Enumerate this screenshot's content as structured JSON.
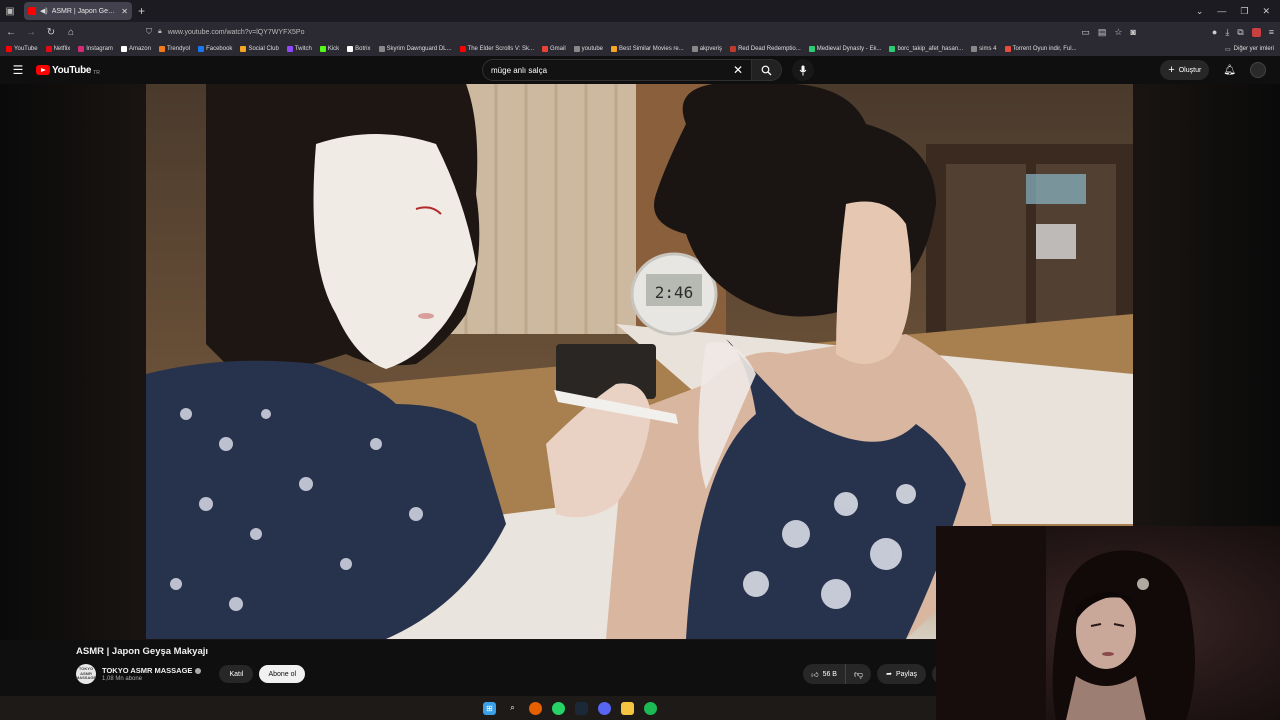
{
  "browser": {
    "tab_title": "ASMR | Japon Geyşa Makyajı",
    "url": "www.youtube.com/watch?v=lQY7WYFX5Po"
  },
  "bookmarks": [
    {
      "label": "YouTube",
      "color": "#ff0000"
    },
    {
      "label": "Netflix",
      "color": "#e50914"
    },
    {
      "label": "Instagram",
      "color": "#d62976"
    },
    {
      "label": "Amazon",
      "color": "#ffffff"
    },
    {
      "label": "Trendyol",
      "color": "#f27a1a"
    },
    {
      "label": "Facebook",
      "color": "#1877f2"
    },
    {
      "label": "Social Club",
      "color": "#f5a623"
    },
    {
      "label": "Twitch",
      "color": "#9146ff"
    },
    {
      "label": "Kick",
      "color": "#53fc18"
    },
    {
      "label": "Botrix",
      "color": "#ffffff"
    },
    {
      "label": "Skyrim Dawnguard DL...",
      "color": "#888888"
    },
    {
      "label": "The Elder Scrolls V: Sk...",
      "color": "#ff0000"
    },
    {
      "label": "Gmail",
      "color": "#ea4335"
    },
    {
      "label": "youtube",
      "color": "#888888"
    },
    {
      "label": "Best Similar Movies re...",
      "color": "#f5a623"
    },
    {
      "label": "akpveriş",
      "color": "#888888"
    },
    {
      "label": "Red Dead Redemptio...",
      "color": "#c0392b"
    },
    {
      "label": "Medieval Dynasty - Ek...",
      "color": "#2ecc71"
    },
    {
      "label": "borc_takip_afet_hasan...",
      "color": "#2ecc71"
    },
    {
      "label": "sims 4",
      "color": "#888888"
    },
    {
      "label": "Torrent Oyun indir, Ful...",
      "color": "#e74c3c"
    }
  ],
  "bookmarks_other": "Diğer yer imleri",
  "youtube": {
    "logo_text": "YouTube",
    "logo_country": "TR",
    "search_query": "müge anlı salça",
    "create_label": "Oluştur"
  },
  "video": {
    "clock_text": "2:46",
    "title": "ASMR | Japon Geyşa Makyajı",
    "channel_name": "TOKYO ASMR MASSAGE",
    "channel_avatar_text": "TOKYO ASMR MASSAGE",
    "subscribers": "1,08 Mn abone",
    "join_label": "Katıl",
    "subscribe_label": "Abone ol",
    "likes": "56 B",
    "share_label": "Paylaş"
  }
}
